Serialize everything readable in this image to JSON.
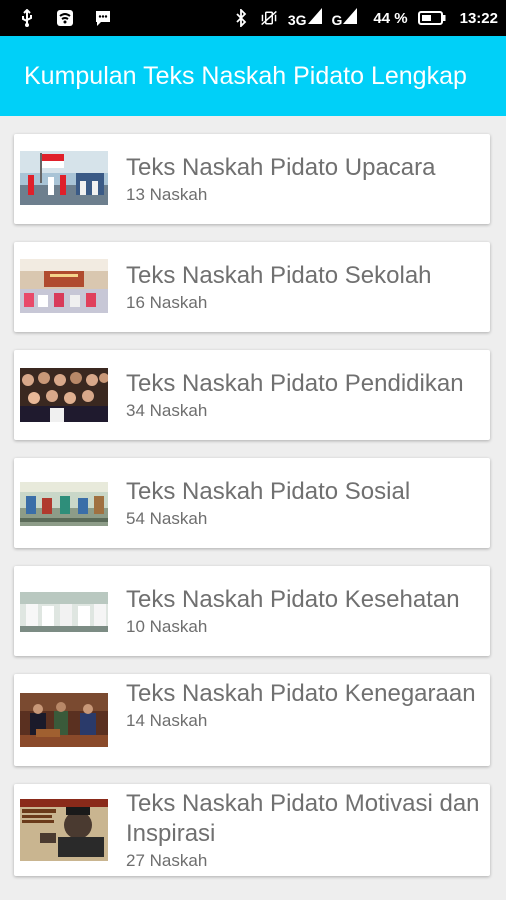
{
  "status_bar": {
    "network": "3G",
    "carrier_signal": "G",
    "battery_percent": "44 %",
    "time": "13:22"
  },
  "app_bar": {
    "title": "Kumpulan Teks Naskah Pidato Lengkap"
  },
  "items": [
    {
      "title": "Teks Naskah Pidato Upacara",
      "count": "13 Naskah",
      "thumb": "flag-ceremony-image"
    },
    {
      "title": "Teks Naskah Pidato Sekolah",
      "count": "16 Naskah",
      "thumb": "school-hall-image"
    },
    {
      "title": "Teks Naskah Pidato Pendidikan",
      "count": "34 Naskah",
      "thumb": "audience-image"
    },
    {
      "title": "Teks Naskah Pidato Sosial",
      "count": "54 Naskah",
      "thumb": "classroom-image"
    },
    {
      "title": "Teks Naskah Pidato Kesehatan",
      "count": "10 Naskah",
      "thumb": "hospital-image"
    },
    {
      "title": "Teks Naskah Pidato Kenegaraan",
      "count": "14 Naskah",
      "thumb": "state-speech-image"
    },
    {
      "title": "Teks Naskah Pidato Motivasi dan Inspirasi",
      "count": "27 Naskah",
      "thumb": "soekarno-poster-image"
    }
  ]
}
